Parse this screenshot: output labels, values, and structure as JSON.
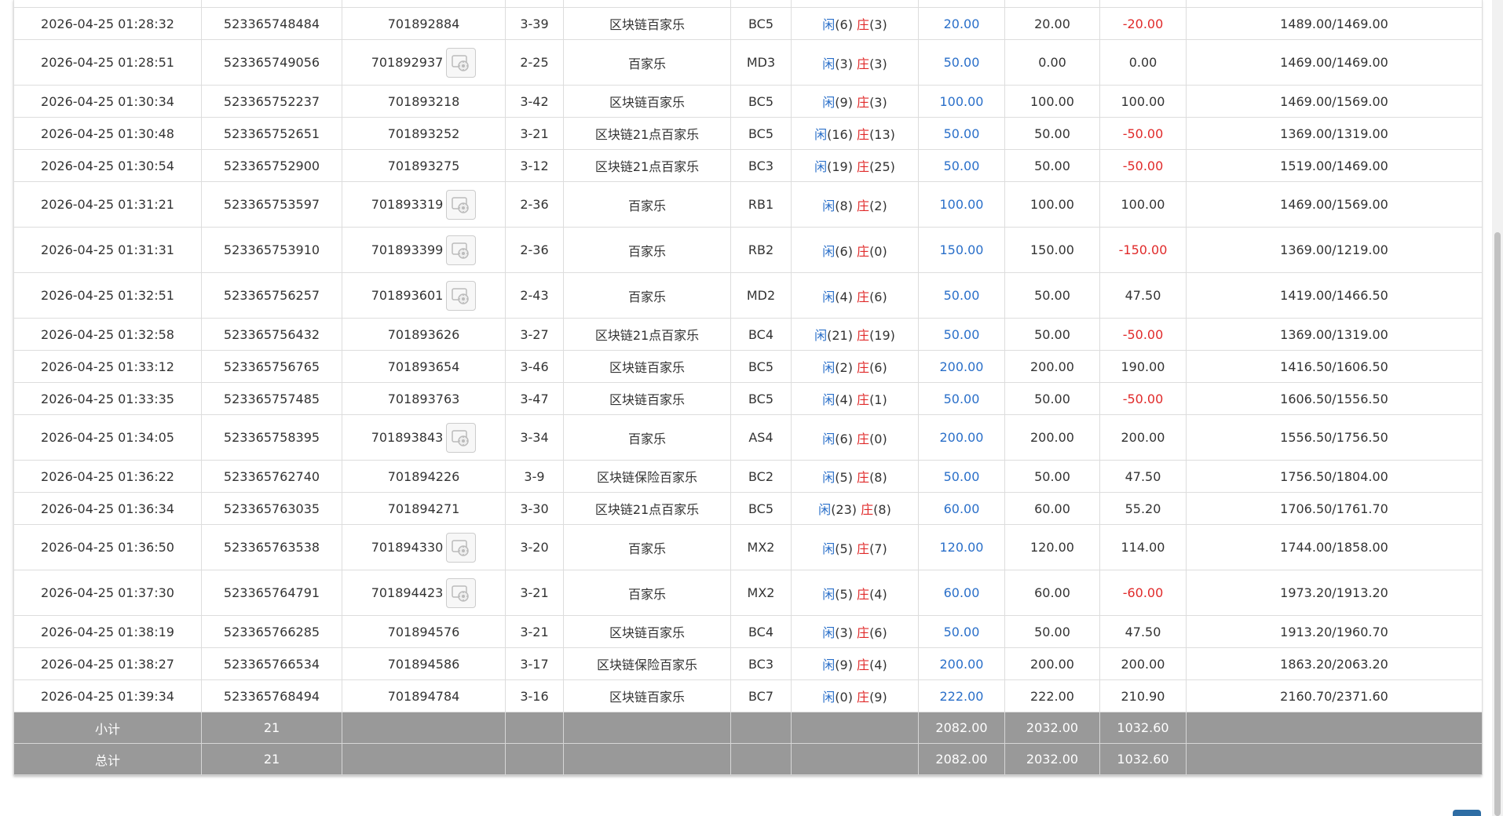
{
  "table": {
    "top_row": [
      "",
      "",
      "",
      "",
      "",
      "",
      "",
      "",
      "",
      "",
      "",
      ""
    ],
    "rows": [
      {
        "time": "2026-04-25 01:28:32",
        "order_no": "523365748484",
        "game_no": "701892884",
        "has_thumb": false,
        "shoe": "3-39",
        "game": "区块链百家乐",
        "table": "BC5",
        "player_label": "闲",
        "player_points": "(6)",
        "banker_label": "庄",
        "banker_points": "(3)",
        "bet": "20.00",
        "valid_bet": "20.00",
        "win_loss": "-20.00",
        "balance": "1489.00/1469.00"
      },
      {
        "time": "2026-04-25 01:28:51",
        "order_no": "523365749056",
        "game_no": "701892937",
        "has_thumb": true,
        "shoe": "2-25",
        "game": "百家乐",
        "table": "MD3",
        "player_label": "闲",
        "player_points": "(3)",
        "banker_label": "庄",
        "banker_points": "(3)",
        "bet": "50.00",
        "valid_bet": "0.00",
        "win_loss": "0.00",
        "balance": "1469.00/1469.00"
      },
      {
        "time": "2026-04-25 01:30:34",
        "order_no": "523365752237",
        "game_no": "701893218",
        "has_thumb": false,
        "shoe": "3-42",
        "game": "区块链百家乐",
        "table": "BC5",
        "player_label": "闲",
        "player_points": "(9)",
        "banker_label": "庄",
        "banker_points": "(3)",
        "bet": "100.00",
        "valid_bet": "100.00",
        "win_loss": "100.00",
        "balance": "1469.00/1569.00"
      },
      {
        "time": "2026-04-25 01:30:48",
        "order_no": "523365752651",
        "game_no": "701893252",
        "has_thumb": false,
        "shoe": "3-21",
        "game": "区块链21点百家乐",
        "table": "BC5",
        "player_label": "闲",
        "player_points": "(16)",
        "banker_label": "庄",
        "banker_points": "(13)",
        "bet": "50.00",
        "valid_bet": "50.00",
        "win_loss": "-50.00",
        "balance": "1369.00/1319.00"
      },
      {
        "time": "2026-04-25 01:30:54",
        "order_no": "523365752900",
        "game_no": "701893275",
        "has_thumb": false,
        "shoe": "3-12",
        "game": "区块链21点百家乐",
        "table": "BC3",
        "player_label": "闲",
        "player_points": "(19)",
        "banker_label": "庄",
        "banker_points": "(25)",
        "bet": "50.00",
        "valid_bet": "50.00",
        "win_loss": "-50.00",
        "balance": "1519.00/1469.00"
      },
      {
        "time": "2026-04-25 01:31:21",
        "order_no": "523365753597",
        "game_no": "701893319",
        "has_thumb": true,
        "shoe": "2-36",
        "game": "百家乐",
        "table": "RB1",
        "player_label": "闲",
        "player_points": "(8)",
        "banker_label": "庄",
        "banker_points": "(2)",
        "bet": "100.00",
        "valid_bet": "100.00",
        "win_loss": "100.00",
        "balance": "1469.00/1569.00"
      },
      {
        "time": "2026-04-25 01:31:31",
        "order_no": "523365753910",
        "game_no": "701893399",
        "has_thumb": true,
        "shoe": "2-36",
        "game": "百家乐",
        "table": "RB2",
        "player_label": "闲",
        "player_points": "(6)",
        "banker_label": "庄",
        "banker_points": "(0)",
        "bet": "150.00",
        "valid_bet": "150.00",
        "win_loss": "-150.00",
        "balance": "1369.00/1219.00"
      },
      {
        "time": "2026-04-25 01:32:51",
        "order_no": "523365756257",
        "game_no": "701893601",
        "has_thumb": true,
        "shoe": "2-43",
        "game": "百家乐",
        "table": "MD2",
        "player_label": "闲",
        "player_points": "(4)",
        "banker_label": "庄",
        "banker_points": "(6)",
        "bet": "50.00",
        "valid_bet": "50.00",
        "win_loss": "47.50",
        "balance": "1419.00/1466.50"
      },
      {
        "time": "2026-04-25 01:32:58",
        "order_no": "523365756432",
        "game_no": "701893626",
        "has_thumb": false,
        "shoe": "3-27",
        "game": "区块链21点百家乐",
        "table": "BC4",
        "player_label": "闲",
        "player_points": "(21)",
        "banker_label": "庄",
        "banker_points": "(19)",
        "bet": "50.00",
        "valid_bet": "50.00",
        "win_loss": "-50.00",
        "balance": "1369.00/1319.00"
      },
      {
        "time": "2026-04-25 01:33:12",
        "order_no": "523365756765",
        "game_no": "701893654",
        "has_thumb": false,
        "shoe": "3-46",
        "game": "区块链百家乐",
        "table": "BC5",
        "player_label": "闲",
        "player_points": "(2)",
        "banker_label": "庄",
        "banker_points": "(6)",
        "bet": "200.00",
        "valid_bet": "200.00",
        "win_loss": "190.00",
        "balance": "1416.50/1606.50"
      },
      {
        "time": "2026-04-25 01:33:35",
        "order_no": "523365757485",
        "game_no": "701893763",
        "has_thumb": false,
        "shoe": "3-47",
        "game": "区块链百家乐",
        "table": "BC5",
        "player_label": "闲",
        "player_points": "(4)",
        "banker_label": "庄",
        "banker_points": "(1)",
        "bet": "50.00",
        "valid_bet": "50.00",
        "win_loss": "-50.00",
        "balance": "1606.50/1556.50"
      },
      {
        "time": "2026-04-25 01:34:05",
        "order_no": "523365758395",
        "game_no": "701893843",
        "has_thumb": true,
        "shoe": "3-34",
        "game": "百家乐",
        "table": "AS4",
        "player_label": "闲",
        "player_points": "(6)",
        "banker_label": "庄",
        "banker_points": "(0)",
        "bet": "200.00",
        "valid_bet": "200.00",
        "win_loss": "200.00",
        "balance": "1556.50/1756.50"
      },
      {
        "time": "2026-04-25 01:36:22",
        "order_no": "523365762740",
        "game_no": "701894226",
        "has_thumb": false,
        "shoe": "3-9",
        "game": "区块链保险百家乐",
        "table": "BC2",
        "player_label": "闲",
        "player_points": "(5)",
        "banker_label": "庄",
        "banker_points": "(8)",
        "bet": "50.00",
        "valid_bet": "50.00",
        "win_loss": "47.50",
        "balance": "1756.50/1804.00"
      },
      {
        "time": "2026-04-25 01:36:34",
        "order_no": "523365763035",
        "game_no": "701894271",
        "has_thumb": false,
        "shoe": "3-30",
        "game": "区块链21点百家乐",
        "table": "BC5",
        "player_label": "闲",
        "player_points": "(23)",
        "banker_label": "庄",
        "banker_points": "(8)",
        "bet": "60.00",
        "valid_bet": "60.00",
        "win_loss": "55.20",
        "balance": "1706.50/1761.70"
      },
      {
        "time": "2026-04-25 01:36:50",
        "order_no": "523365763538",
        "game_no": "701894330",
        "has_thumb": true,
        "shoe": "3-20",
        "game": "百家乐",
        "table": "MX2",
        "player_label": "闲",
        "player_points": "(5)",
        "banker_label": "庄",
        "banker_points": "(7)",
        "bet": "120.00",
        "valid_bet": "120.00",
        "win_loss": "114.00",
        "balance": "1744.00/1858.00"
      },
      {
        "time": "2026-04-25 01:37:30",
        "order_no": "523365764791",
        "game_no": "701894423",
        "has_thumb": true,
        "shoe": "3-21",
        "game": "百家乐",
        "table": "MX2",
        "player_label": "闲",
        "player_points": "(5)",
        "banker_label": "庄",
        "banker_points": "(4)",
        "bet": "60.00",
        "valid_bet": "60.00",
        "win_loss": "-60.00",
        "balance": "1973.20/1913.20"
      },
      {
        "time": "2026-04-25 01:38:19",
        "order_no": "523365766285",
        "game_no": "701894576",
        "has_thumb": false,
        "shoe": "3-21",
        "game": "区块链百家乐",
        "table": "BC4",
        "player_label": "闲",
        "player_points": "(3)",
        "banker_label": "庄",
        "banker_points": "(6)",
        "bet": "50.00",
        "valid_bet": "50.00",
        "win_loss": "47.50",
        "balance": "1913.20/1960.70"
      },
      {
        "time": "2026-04-25 01:38:27",
        "order_no": "523365766534",
        "game_no": "701894586",
        "has_thumb": false,
        "shoe": "3-17",
        "game": "区块链保险百家乐",
        "table": "BC3",
        "player_label": "闲",
        "player_points": "(9)",
        "banker_label": "庄",
        "banker_points": "(4)",
        "bet": "200.00",
        "valid_bet": "200.00",
        "win_loss": "200.00",
        "balance": "1863.20/2063.20"
      },
      {
        "time": "2026-04-25 01:39:34",
        "order_no": "523365768494",
        "game_no": "701894784",
        "has_thumb": false,
        "shoe": "3-16",
        "game": "区块链百家乐",
        "table": "BC7",
        "player_label": "闲",
        "player_points": "(0)",
        "banker_label": "庄",
        "banker_points": "(9)",
        "bet": "222.00",
        "valid_bet": "222.00",
        "win_loss": "210.90",
        "balance": "2160.70/2371.60"
      }
    ],
    "summary": [
      {
        "label": "小计",
        "count": "21",
        "bet": "2082.00",
        "valid_bet": "2032.00",
        "win_loss": "1032.60"
      },
      {
        "label": "总计",
        "count": "21",
        "bet": "2082.00",
        "valid_bet": "2032.00",
        "win_loss": "1032.60"
      }
    ]
  },
  "colors": {
    "positive": "#2a6fc9",
    "negative": "#e02a2a",
    "summary_bg": "#999999",
    "button": "#2e6da4"
  },
  "icons": {
    "thumb": "replay-thumbnail-icon"
  }
}
